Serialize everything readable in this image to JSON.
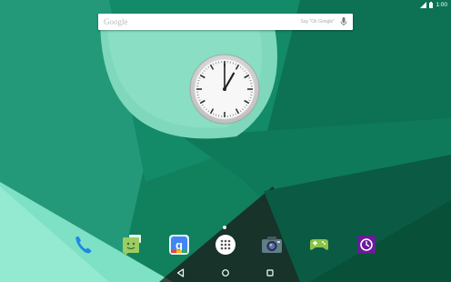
{
  "status_bar": {
    "time": "1:00",
    "icons": [
      "signal-icon",
      "battery-icon"
    ]
  },
  "search": {
    "logo_text": "Google",
    "hint": "Say \"Ok Google\"",
    "icon": "mic-icon"
  },
  "clock": {
    "hour": 1,
    "minute": 0,
    "second": 0
  },
  "page_indicator": {
    "pages": 1,
    "current": 1
  },
  "dock": {
    "apps": [
      {
        "name": "Phone",
        "icon": "phone-icon",
        "color": "#1e88e5"
      },
      {
        "name": "Messenger",
        "icon": "messenger-icon",
        "color": "#9ccc65"
      },
      {
        "name": "Google+",
        "icon": "google-plus-icon",
        "color": "#4285f4"
      },
      {
        "name": "Apps",
        "icon": "app-drawer-icon",
        "color": "#ffffff"
      },
      {
        "name": "Camera",
        "icon": "camera-icon",
        "color": "#607d8b"
      },
      {
        "name": "Play Games",
        "icon": "play-games-icon",
        "color": "#8bc34a"
      },
      {
        "name": "Clock",
        "icon": "clock-icon",
        "color": "#6a1b9a"
      }
    ]
  },
  "nav_bar": {
    "buttons": [
      "back-icon",
      "home-icon",
      "recents-icon"
    ]
  },
  "colors": {
    "wallpaper_base": "#0f7a5a",
    "wallpaper_light": "#46b394",
    "wallpaper_mint": "#8ee0c6",
    "wallpaper_dark": "#0b5a44"
  }
}
